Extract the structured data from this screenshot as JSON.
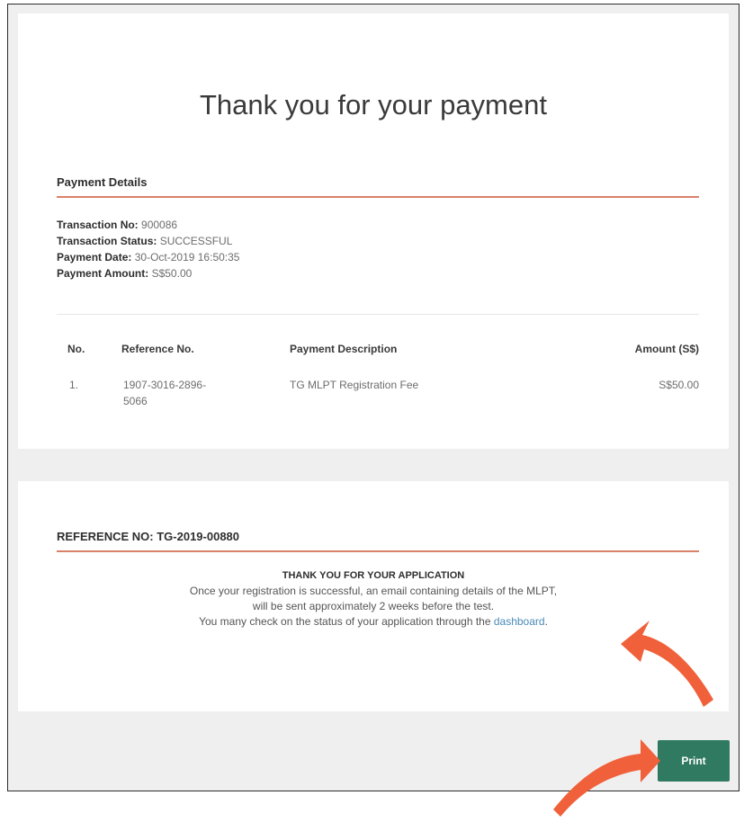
{
  "page": {
    "title": "Thank you for your payment"
  },
  "payment_details": {
    "heading": "Payment Details",
    "transaction_no_label": "Transaction No:",
    "transaction_no": "900086",
    "transaction_status_label": "Transaction Status:",
    "transaction_status": "SUCCESSFUL",
    "payment_date_label": "Payment Date:",
    "payment_date": "30-Oct-2019 16:50:35",
    "payment_amount_label": "Payment Amount:",
    "payment_amount": "S$50.00"
  },
  "table": {
    "headers": {
      "no": "No.",
      "reference": "Reference No.",
      "description": "Payment Description",
      "amount": "Amount (S$)"
    },
    "rows": [
      {
        "no": "1.",
        "reference_line1": "1907-3016-2896-",
        "reference_line2": "5066",
        "description": "TG MLPT Registration Fee",
        "amount": "S$50.00"
      }
    ]
  },
  "application": {
    "heading": "REFERENCE NO: TG-2019-00880",
    "thanks": "THANK YOU FOR YOUR APPLICATION",
    "line1": "Once your registration is successful, an email containing details of the MLPT,",
    "line2": "will be sent approximately 2 weeks before the test.",
    "line3_prefix": "You many check on the status of your application through the ",
    "line3_link": "dashboard",
    "line3_suffix": "."
  },
  "actions": {
    "print_label": "Print"
  },
  "colors": {
    "accent_rule": "#d9826a",
    "print_button": "#2f7a60",
    "link": "#4a8ab8",
    "annotation_arrow": "#f0603a"
  },
  "annotations": {
    "arrow_icon": "curved-arrow-icon"
  }
}
